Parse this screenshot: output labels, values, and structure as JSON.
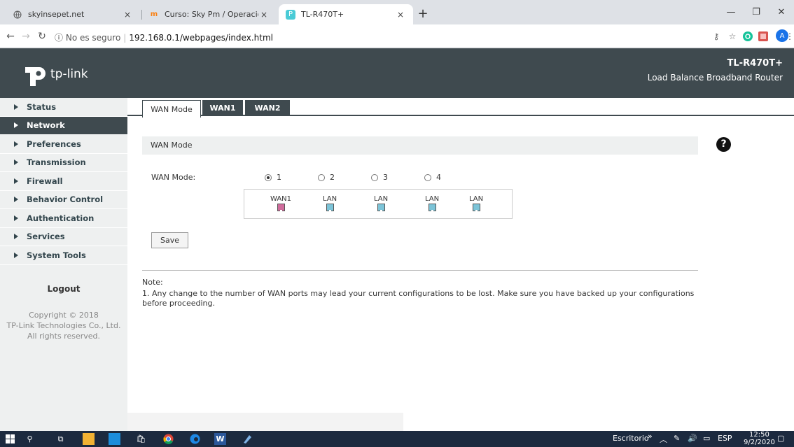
{
  "browser": {
    "tabs": [
      {
        "title": "skyinsepet.net",
        "favicon": "globe-icon"
      },
      {
        "title": "Curso: Sky Pm / Operacion",
        "favicon": "moodle-icon"
      },
      {
        "title": "TL-R470T+",
        "favicon": "tplink-icon"
      }
    ],
    "new_tab": "+",
    "address": {
      "security": "No es seguro",
      "url": "192.168.0.1/webpages/index.html"
    },
    "profile_initial": "A"
  },
  "header": {
    "logo_text": "tp-link",
    "model": "TL-R470T+",
    "subtitle": "Load Balance Broadband Router"
  },
  "sidebar": {
    "items": [
      {
        "label": "Status",
        "active": false
      },
      {
        "label": "Network",
        "active": true
      },
      {
        "label": "Preferences",
        "active": false
      },
      {
        "label": "Transmission",
        "active": false
      },
      {
        "label": "Firewall",
        "active": false
      },
      {
        "label": "Behavior Control",
        "active": false
      },
      {
        "label": "Authentication",
        "active": false
      },
      {
        "label": "Services",
        "active": false
      },
      {
        "label": "System Tools",
        "active": false
      }
    ],
    "logout": "Logout",
    "copyright": [
      "Copyright © 2018",
      "TP-Link Technologies Co., Ltd.",
      "All rights reserved."
    ]
  },
  "content": {
    "tabs": [
      {
        "label": "WAN Mode",
        "selected": true
      },
      {
        "label": "WAN1",
        "selected": false
      },
      {
        "label": "WAN2",
        "selected": false
      }
    ],
    "section_title": "WAN Mode",
    "help": "?",
    "wan_mode_label": "WAN Mode:",
    "radio_options": [
      {
        "label": "1",
        "checked": true
      },
      {
        "label": "2",
        "checked": false
      },
      {
        "label": "3",
        "checked": false
      },
      {
        "label": "4",
        "checked": false
      }
    ],
    "ports": [
      {
        "label": "WAN1",
        "color": "#d06c9c"
      },
      {
        "label": "LAN",
        "color": "#7cc4d8"
      },
      {
        "label": "LAN",
        "color": "#7cc4d8"
      },
      {
        "label": "LAN",
        "color": "#7cc4d8"
      },
      {
        "label": "LAN",
        "color": "#7cc4d8"
      }
    ],
    "save_label": "Save",
    "note_title": "Note:",
    "note_text": "1. Any change to the number of WAN ports may lead your current configurations to be lost. Make sure you have backed up your configurations before proceeding."
  },
  "taskbar": {
    "desktop": "Escritorio",
    "chevron": "»",
    "language": "ESP",
    "time": "12:50",
    "date": "9/2/2020"
  },
  "colors": {
    "dark": "#3f4a4f",
    "sidebar_bg": "#eef0f0",
    "taskbar": "#1c2a3f"
  }
}
